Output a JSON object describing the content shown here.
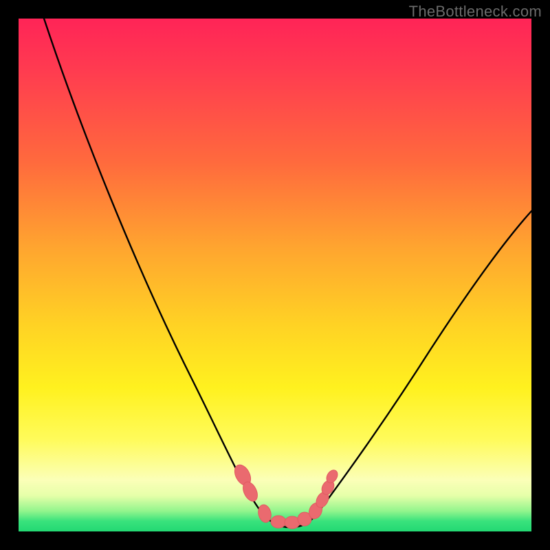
{
  "watermark": {
    "text": "TheBottleneck.com"
  },
  "chart_data": {
    "type": "line",
    "title": "",
    "xlabel": "",
    "ylabel": "",
    "xlim": [
      0,
      100
    ],
    "ylim": [
      0,
      100
    ],
    "series": [
      {
        "name": "bottleneck-curve",
        "x": [
          5,
          10,
          15,
          20,
          25,
          30,
          35,
          40,
          43,
          46,
          48,
          50,
          52,
          54,
          56,
          58,
          61,
          65,
          70,
          75,
          80,
          85,
          90,
          95,
          100
        ],
        "y": [
          100,
          90,
          80,
          70,
          58,
          46,
          34,
          22,
          14,
          8,
          4,
          2,
          2,
          2,
          3,
          4,
          7,
          12,
          20,
          28,
          36,
          44,
          52,
          58,
          62
        ]
      }
    ],
    "markers": {
      "name": "highlighted-points",
      "color": "#ea6a6f",
      "x": [
        43.5,
        45.0,
        48.0,
        50.0,
        52.0,
        54.0,
        56.0,
        57.8,
        59.3,
        60.2
      ],
      "y": [
        11.0,
        8.0,
        3.0,
        1.8,
        1.8,
        2.0,
        2.6,
        3.8,
        6.2,
        8.8
      ]
    },
    "background_gradient": {
      "stops": [
        {
          "pos": 0.0,
          "color": "#ff2457"
        },
        {
          "pos": 0.45,
          "color": "#ffa62f"
        },
        {
          "pos": 0.72,
          "color": "#fff11f"
        },
        {
          "pos": 0.92,
          "color": "#e6ffa9"
        },
        {
          "pos": 1.0,
          "color": "#23d873"
        }
      ]
    }
  }
}
